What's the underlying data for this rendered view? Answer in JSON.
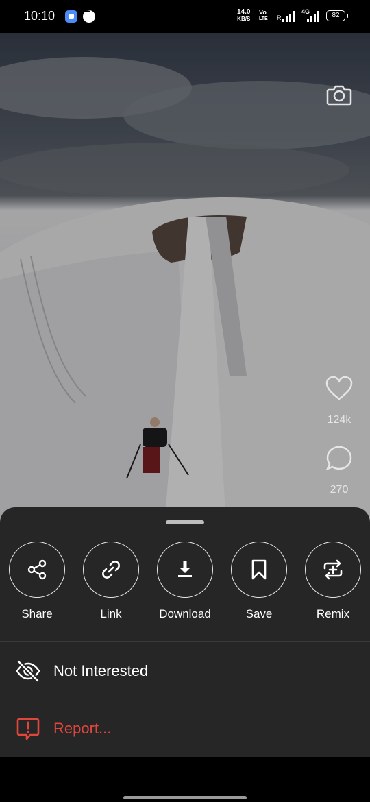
{
  "status_bar": {
    "time": "10:10",
    "speed_value": "14.0",
    "speed_unit": "KB/S",
    "volte_top": "Vo",
    "volte_bottom": "LTE",
    "roaming": "R",
    "network": "4G",
    "battery": "82"
  },
  "video": {
    "like_count": "124k",
    "comment_count": "270"
  },
  "sheet": {
    "actions": [
      {
        "label": "Share",
        "icon": "share-icon"
      },
      {
        "label": "Link",
        "icon": "link-icon"
      },
      {
        "label": "Download",
        "icon": "download-icon"
      },
      {
        "label": "Save",
        "icon": "bookmark-icon"
      },
      {
        "label": "Remix",
        "icon": "remix-icon"
      }
    ],
    "not_interested_label": "Not Interested",
    "report_label": "Report..."
  },
  "colors": {
    "sheet_bg": "#262626",
    "report_red": "#e0463c"
  }
}
